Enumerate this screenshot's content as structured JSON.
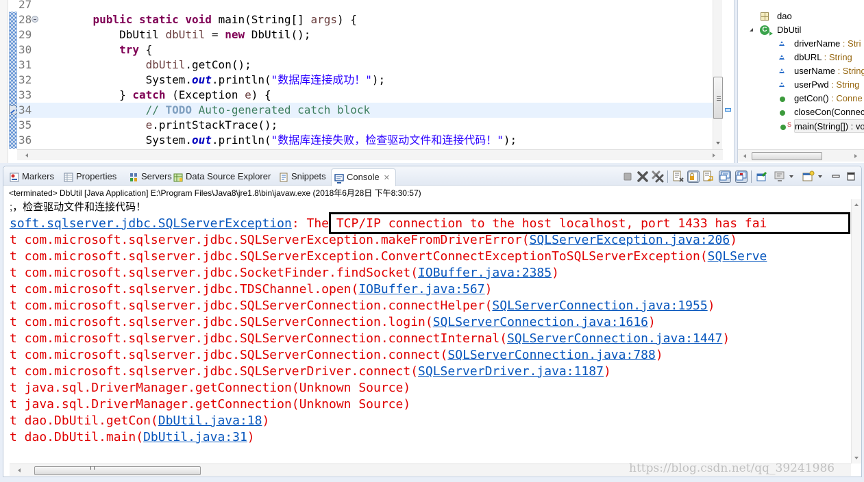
{
  "editor": {
    "lines": [
      {
        "num": "27",
        "tokens": []
      },
      {
        "num": "28",
        "fold": true,
        "tokens": [
          {
            "t": "    ",
            "c": ""
          },
          {
            "t": "public",
            "c": "kw"
          },
          {
            "t": " ",
            "c": ""
          },
          {
            "t": "static",
            "c": "kw"
          },
          {
            "t": " ",
            "c": ""
          },
          {
            "t": "void",
            "c": "kw"
          },
          {
            "t": " main(String[] ",
            "c": ""
          },
          {
            "t": "args",
            "c": "var"
          },
          {
            "t": ") {",
            "c": ""
          }
        ]
      },
      {
        "num": "29",
        "tokens": [
          {
            "t": "        DbUtil ",
            "c": ""
          },
          {
            "t": "dbUtil",
            "c": "var"
          },
          {
            "t": " = ",
            "c": ""
          },
          {
            "t": "new",
            "c": "kw"
          },
          {
            "t": " DbUtil();",
            "c": ""
          }
        ]
      },
      {
        "num": "30",
        "tokens": [
          {
            "t": "        ",
            "c": ""
          },
          {
            "t": "try",
            "c": "kw"
          },
          {
            "t": " {",
            "c": ""
          }
        ]
      },
      {
        "num": "31",
        "tokens": [
          {
            "t": "            ",
            "c": ""
          },
          {
            "t": "dbUtil",
            "c": "var"
          },
          {
            "t": ".getCon();",
            "c": ""
          }
        ]
      },
      {
        "num": "32",
        "tokens": [
          {
            "t": "            System.",
            "c": ""
          },
          {
            "t": "out",
            "c": "fld"
          },
          {
            "t": ".println(",
            "c": ""
          },
          {
            "t": "\"数据库连接成功！\"",
            "c": "str"
          },
          {
            "t": ");",
            "c": ""
          }
        ]
      },
      {
        "num": "33",
        "tokens": [
          {
            "t": "        } ",
            "c": ""
          },
          {
            "t": "catch",
            "c": "kw"
          },
          {
            "t": " (Exception ",
            "c": ""
          },
          {
            "t": "e",
            "c": "var"
          },
          {
            "t": ") {",
            "c": ""
          }
        ]
      },
      {
        "num": "34",
        "highlight": true,
        "task": true,
        "tokens": [
          {
            "t": "            // ",
            "c": "cmt"
          },
          {
            "t": "TODO",
            "c": "todo"
          },
          {
            "t": " Auto-generated catch block",
            "c": "cmt"
          }
        ]
      },
      {
        "num": "35",
        "tokens": [
          {
            "t": "            ",
            "c": ""
          },
          {
            "t": "e",
            "c": "var"
          },
          {
            "t": ".printStackTrace();",
            "c": ""
          }
        ]
      },
      {
        "num": "36",
        "tokens": [
          {
            "t": "            System.",
            "c": ""
          },
          {
            "t": "out",
            "c": "fld"
          },
          {
            "t": ".println(",
            "c": ""
          },
          {
            "t": "\"数据库连接失败，检查驱动文件和连接代码！\"",
            "c": "str"
          },
          {
            "t": ");",
            "c": ""
          }
        ]
      }
    ]
  },
  "outline": {
    "package": "dao",
    "class": "DbUtil",
    "class_icon_letter": "C",
    "members": [
      {
        "kind": "field",
        "name": "driverName",
        "type": " : Stri"
      },
      {
        "kind": "field",
        "name": "dbURL",
        "type": " : String"
      },
      {
        "kind": "field",
        "name": "userName",
        "type": " : String"
      },
      {
        "kind": "field",
        "name": "userPwd",
        "type": " : String"
      },
      {
        "kind": "method",
        "name": "getCon()",
        "type": " : Conne"
      },
      {
        "kind": "method",
        "name": "closeCon(Connec",
        "type": ""
      },
      {
        "kind": "method",
        "name": "main(String[]) : vo",
        "type": "",
        "static": true,
        "selected": true
      }
    ]
  },
  "console_view": {
    "tabs": [
      {
        "label": "Markers",
        "icon": "markers-icon"
      },
      {
        "label": "Properties",
        "icon": "properties-icon"
      },
      {
        "label": "Servers",
        "icon": "servers-icon"
      },
      {
        "label": "Data Source Explorer",
        "icon": "data-source-explorer-icon"
      },
      {
        "label": "Snippets",
        "icon": "snippets-icon"
      },
      {
        "label": "Console",
        "icon": "console-icon",
        "active": true,
        "close": "✕"
      }
    ],
    "toolbar": [
      "terminate-icon",
      "remove-launch-icon",
      "remove-all-terminated-icon",
      "clear-console-icon",
      "scroll-lock-icon",
      "word-wrap-icon",
      "show-on-stdout-icon",
      "show-on-stderr-icon",
      "pin-console-icon",
      "display-selected-console-icon",
      "open-console-icon",
      "minimize-icon",
      "maximize-icon"
    ],
    "status": "<terminated> DbUtil [Java Application] E:\\Program Files\\Java8\\jre1.8\\bin\\javaw.exe (2018年6月28日 下午8:30:57)",
    "output": [
      {
        "type": "plain",
        "text": ";，检查驱动文件和连接代码！"
      },
      {
        "type": "exception",
        "link": "soft.sqlserver.jdbc.SQLServerException",
        "text": ": The TCP/IP connection to the host localhost, port 1433 has fai"
      },
      {
        "type": "frame",
        "pre": "t com.microsoft.sqlserver.jdbc.SQLServerException.makeFromDriverError(",
        "link": "SQLServerException.java:206",
        "post": ")"
      },
      {
        "type": "frame",
        "pre": "t com.microsoft.sqlserver.jdbc.SQLServerException.ConvertConnectExceptionToSQLServerException(",
        "link": "SQLServe",
        "post": ""
      },
      {
        "type": "frame",
        "pre": "t com.microsoft.sqlserver.jdbc.SocketFinder.findSocket(",
        "link": "IOBuffer.java:2385",
        "post": ")"
      },
      {
        "type": "frame",
        "pre": "t com.microsoft.sqlserver.jdbc.TDSChannel.open(",
        "link": "IOBuffer.java:567",
        "post": ")"
      },
      {
        "type": "frame",
        "pre": "t com.microsoft.sqlserver.jdbc.SQLServerConnection.connectHelper(",
        "link": "SQLServerConnection.java:1955",
        "post": ")"
      },
      {
        "type": "frame",
        "pre": "t com.microsoft.sqlserver.jdbc.SQLServerConnection.login(",
        "link": "SQLServerConnection.java:1616",
        "post": ")"
      },
      {
        "type": "frame",
        "pre": "t com.microsoft.sqlserver.jdbc.SQLServerConnection.connectInternal(",
        "link": "SQLServerConnection.java:1447",
        "post": ")"
      },
      {
        "type": "frame",
        "pre": "t com.microsoft.sqlserver.jdbc.SQLServerConnection.connect(",
        "link": "SQLServerConnection.java:788",
        "post": ")"
      },
      {
        "type": "frame",
        "pre": "t com.microsoft.sqlserver.jdbc.SQLServerDriver.connect(",
        "link": "SQLServerDriver.java:1187",
        "post": ")"
      },
      {
        "type": "frame",
        "pre": "t java.sql.DriverManager.getConnection(Unknown Source)",
        "link": "",
        "post": ""
      },
      {
        "type": "frame",
        "pre": "t java.sql.DriverManager.getConnection(Unknown Source)",
        "link": "",
        "post": ""
      },
      {
        "type": "frame",
        "pre": "t dao.DbUtil.getCon(",
        "link": "DbUtil.java:18",
        "post": ")"
      },
      {
        "type": "frame",
        "pre": "t dao.DbUtil.main(",
        "link": "DbUtil.java:31",
        "post": ")"
      }
    ]
  },
  "watermark": "https://blog.csdn.net/qq_39241986"
}
